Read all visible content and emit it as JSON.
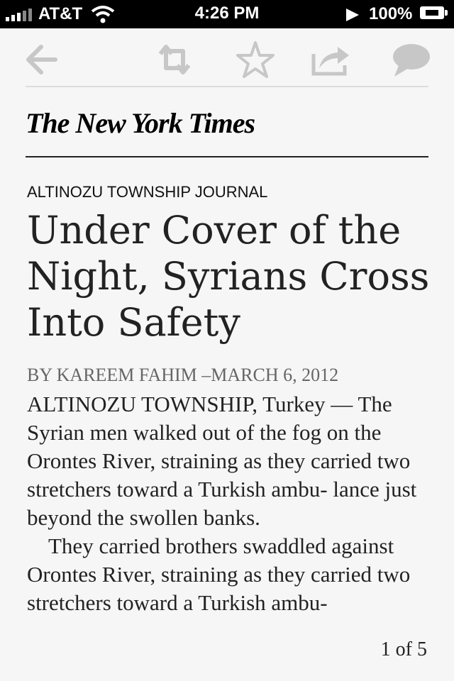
{
  "status_bar": {
    "carrier": "AT&T",
    "time": "4:26 PM",
    "battery": "100%",
    "icons": [
      "signal-icon",
      "wifi-icon",
      "play-icon",
      "battery-charging-icon"
    ]
  },
  "toolbar": {
    "icons": [
      "back-arrow-icon",
      "retweet-icon",
      "star-icon",
      "share-icon",
      "comment-icon"
    ],
    "icon_color": "#c7c7c7"
  },
  "masthead": {
    "title": "The New York Times"
  },
  "article": {
    "kicker": "ALTINOZU TOWNSHIP JOURNAL",
    "headline": "Under Cover of the Night, Syrians Cross Into Safety",
    "byline": "BY KAREEM FAHIM –MARCH 6, 2012",
    "paragraphs": [
      "ALTINOZU TOWNSHIP, Turkey — The Syrian men walked out of the fog on the Orontes River, straining as they carried two stretchers toward a Turkish ambu- lance just beyond the swollen banks.",
      "They carried brothers swaddled against Orontes River, straining as they carried two stretchers toward a Turkish ambu-"
    ]
  },
  "pagination": {
    "label": "1 of 5"
  },
  "colors": {
    "background": "#f6f6f6",
    "text": "#222222",
    "byline": "#666666"
  }
}
